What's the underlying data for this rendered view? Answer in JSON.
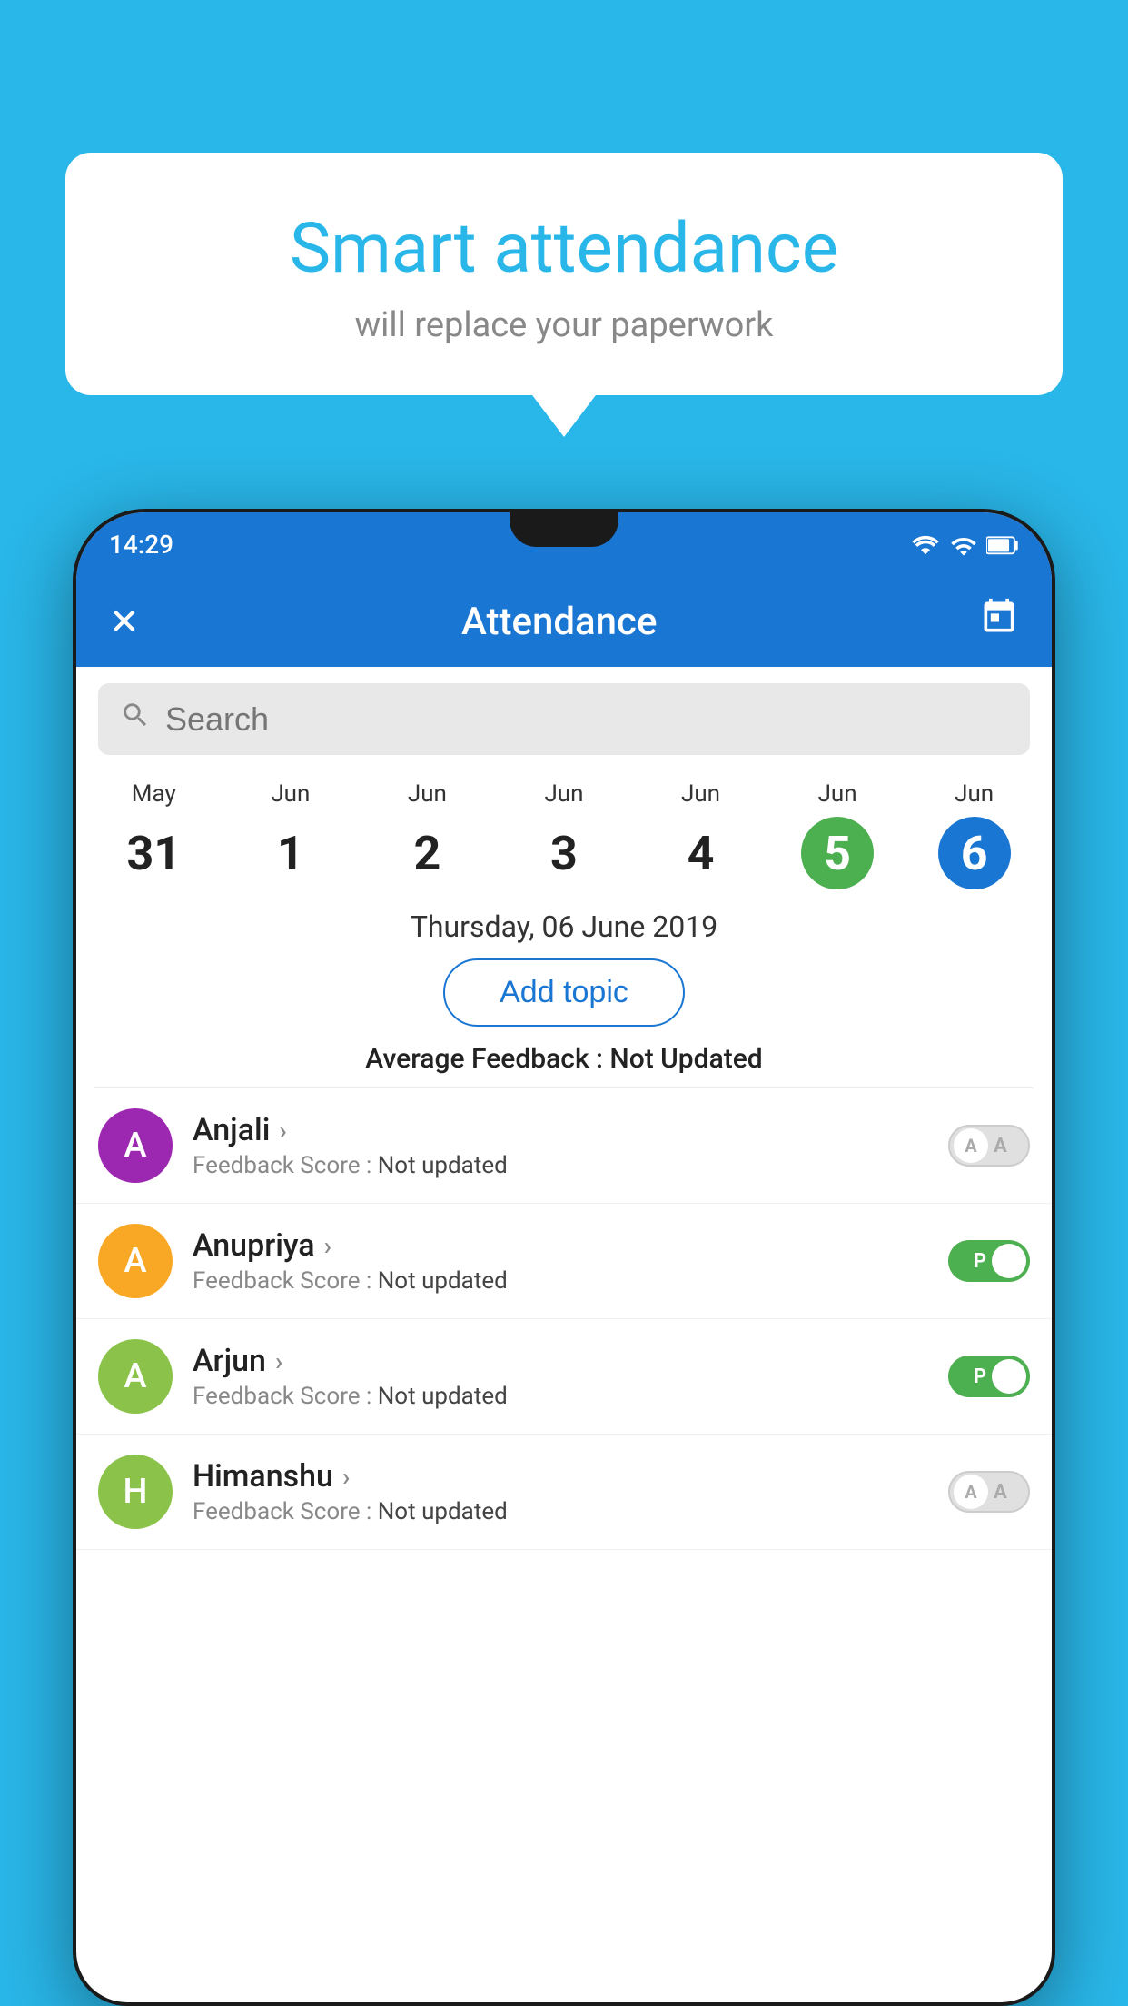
{
  "background_color": "#29b6e8",
  "bubble": {
    "title": "Smart attendance",
    "subtitle": "will replace your paperwork"
  },
  "status_bar": {
    "time": "14:29",
    "wifi_icon": "wifi",
    "signal_icon": "signal",
    "battery_icon": "battery"
  },
  "app_bar": {
    "close_icon": "✕",
    "title": "Attendance",
    "calendar_icon": "📅"
  },
  "search": {
    "placeholder": "Search"
  },
  "calendar": {
    "days": [
      {
        "month": "May",
        "num": "31",
        "state": "normal"
      },
      {
        "month": "Jun",
        "num": "1",
        "state": "normal"
      },
      {
        "month": "Jun",
        "num": "2",
        "state": "normal"
      },
      {
        "month": "Jun",
        "num": "3",
        "state": "normal"
      },
      {
        "month": "Jun",
        "num": "4",
        "state": "normal"
      },
      {
        "month": "Jun",
        "num": "5",
        "state": "today"
      },
      {
        "month": "Jun",
        "num": "6",
        "state": "selected"
      }
    ]
  },
  "selected_date": "Thursday, 06 June 2019",
  "add_topic_label": "Add topic",
  "avg_feedback_label": "Average Feedback :",
  "avg_feedback_value": "Not Updated",
  "students": [
    {
      "name": "Anjali",
      "avatar_letter": "A",
      "avatar_color": "#9c27b0",
      "feedback_label": "Feedback Score :",
      "feedback_value": "Not updated",
      "toggle_state": "off",
      "toggle_letter": "A"
    },
    {
      "name": "Anupriya",
      "avatar_letter": "A",
      "avatar_color": "#f9a825",
      "feedback_label": "Feedback Score :",
      "feedback_value": "Not updated",
      "toggle_state": "on",
      "toggle_letter": "P"
    },
    {
      "name": "Arjun",
      "avatar_letter": "A",
      "avatar_color": "#8bc34a",
      "feedback_label": "Feedback Score :",
      "feedback_value": "Not updated",
      "toggle_state": "on",
      "toggle_letter": "P"
    },
    {
      "name": "Himanshu",
      "avatar_letter": "H",
      "avatar_color": "#8bc34a",
      "feedback_label": "Feedback Score :",
      "feedback_value": "Not updated",
      "toggle_state": "off",
      "toggle_letter": "A"
    }
  ]
}
